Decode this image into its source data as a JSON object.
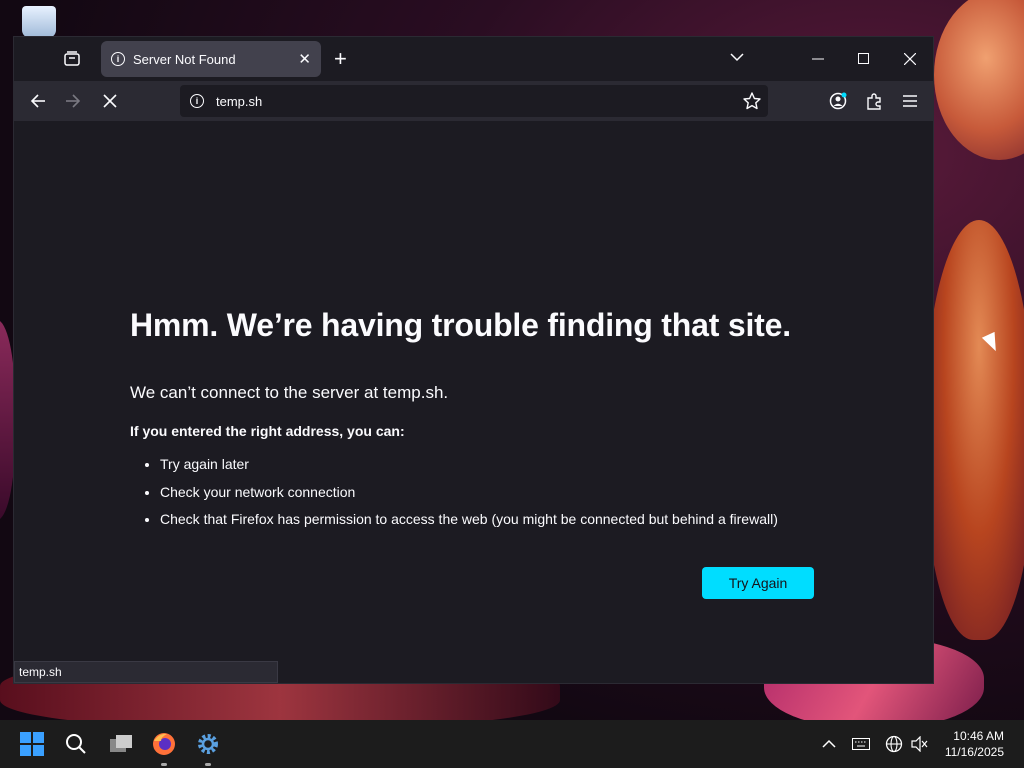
{
  "browser": {
    "tab": {
      "title": "Server Not Found"
    },
    "url": "temp.sh",
    "status_text": "temp.sh"
  },
  "error": {
    "title": "Hmm. We’re having trouble finding that site.",
    "description": "We can’t connect to the server at temp.sh.",
    "subheading": "If you entered the right address, you can:",
    "suggestions": [
      "Try again later",
      "Check your network connection",
      "Check that Firefox has permission to access the web (you might be connected but behind a firewall)"
    ],
    "button_label": "Try Again"
  },
  "taskbar": {
    "time": "10:46 AM",
    "date": "11/16/2025"
  },
  "colors": {
    "accent": "#00ddff",
    "page_bg": "#1c1b22",
    "toolbar_bg": "#2b2a33"
  }
}
